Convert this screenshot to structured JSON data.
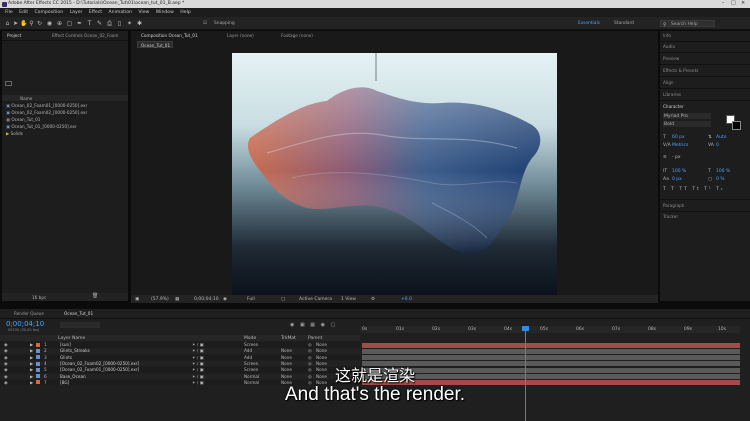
{
  "window": {
    "title": "Adobe After Effects CC 2015 - D:\\Tutorials\\Ocean_Tut\\01\\ocean_tut_01_B.aep *"
  },
  "menu": [
    "File",
    "Edit",
    "Composition",
    "Layer",
    "Effect",
    "Animation",
    "View",
    "Window",
    "Help"
  ],
  "toolbar": {
    "snapping_label": "Snapping",
    "workspace_label": "Essentials",
    "workspace_alt": "Standard",
    "search_label": "Search Help"
  },
  "project_panel": {
    "tab_project": "Project",
    "tab_effect_controls": "Effect Controls Ocean_02_Foam",
    "name_header": "Name",
    "items": [
      "Ocean_02_Foam01_[0000-0250].exr",
      "Ocean_02_Foam02_[0000-0250].exr",
      "Ocean_Tut_01",
      "Ocean_Tut_01_[0000-0250].exr",
      "Solids"
    ],
    "bpc": "16 bpc"
  },
  "viewer": {
    "tab_composition": "Composition Ocean_Tut_01",
    "tab_layer": "Layer (none)",
    "tab_footage": "Footage (none)",
    "comp_label": "Ocean_Tut_01",
    "zoom": "(57.9%)",
    "timecode": "0;00;04;10",
    "resolution": "Full",
    "camera": "Active Camera",
    "views": "1 View",
    "exposure": "+0.0"
  },
  "right_panel": {
    "info": "Info",
    "audio": "Audio",
    "preview": "Preview",
    "effects_presets": "Effects & Presets",
    "align": "Align",
    "libraries": "Libraries",
    "character": "Character",
    "font": "Myriad Pro",
    "font_style": "Bold",
    "font_size": "60 px",
    "leading": "Auto",
    "kerning": "Metrics",
    "tracking": "0",
    "stroke_width": "- px",
    "v_scale": "100 %",
    "h_scale": "100 %",
    "baseline": "0 px",
    "tsume": "0 %",
    "paragraph": "Paragraph",
    "tracker": "Tracker"
  },
  "timeline": {
    "tab_render_queue": "Render Queue",
    "tab_comp": "Ocean_Tut_01",
    "timecode": "0;00;04;10",
    "timecode_sub": "00130 (30.00 fps)",
    "col_layer_name": "Layer Name",
    "col_mode": "Mode",
    "col_trkmat": "TrkMat",
    "col_parent": "Parent",
    "ruler_marks": [
      "0s",
      "01s",
      "02s",
      "03s",
      "04s",
      "05s",
      "06s",
      "07s",
      "08s",
      "09s",
      "10s"
    ],
    "layers": [
      {
        "num": "1",
        "name": "[sun]",
        "mode": "Screen",
        "trkmat": "",
        "parent": "None",
        "color": "#d86a3a"
      },
      {
        "num": "2",
        "name": "Glints_Streaks",
        "mode": "Add",
        "trkmat": "None",
        "parent": "None",
        "color": "#6b8fc7"
      },
      {
        "num": "3",
        "name": "Glints",
        "mode": "Add",
        "trkmat": "None",
        "parent": "None",
        "color": "#6b8fc7"
      },
      {
        "num": "4",
        "name": "[Ocean_02_Foam02_[0000-0250].exr]",
        "mode": "Screen",
        "trkmat": "None",
        "parent": "None",
        "color": "#6b8fc7"
      },
      {
        "num": "5",
        "name": "[Ocean_02_Foam01_[0000-0250].exr]",
        "mode": "Screen",
        "trkmat": "None",
        "parent": "None",
        "color": "#6b8fc7"
      },
      {
        "num": "6",
        "name": "Base_Ocean",
        "mode": "Normal",
        "trkmat": "None",
        "parent": "None",
        "color": "#6b8fc7"
      },
      {
        "num": "7",
        "name": "[BG]",
        "mode": "Normal",
        "trkmat": "None",
        "parent": "None",
        "color": "#d86a3a"
      }
    ]
  },
  "subtitles": {
    "chinese": "这就是渲染",
    "english": "And that's the render."
  },
  "colors": {
    "ui_bg": "#1d1d1d",
    "accent_blue": "#2d8ceb",
    "layer_bar_red": "#a34b48",
    "layer_bar_gray": "#5a5a5a"
  }
}
